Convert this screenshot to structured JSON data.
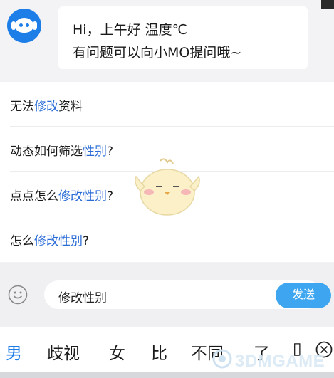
{
  "chat": {
    "greeting_line1": "Hi，上午好 温度℃",
    "greeting_line2": "有问题可以向小MO提问哦~"
  },
  "suggestions": [
    {
      "before": "无法",
      "highlight": "修改",
      "after": "资料"
    },
    {
      "before": "动态如何筛选",
      "highlight": "性别",
      "after": "?"
    },
    {
      "before": "点点怎么",
      "highlight": "修改性别",
      "after": "?"
    },
    {
      "before": "怎么",
      "highlight": "修改性别",
      "after": "?"
    }
  ],
  "input": {
    "value": "修改性别",
    "send_label": "发送"
  },
  "keyboard": {
    "candidates": [
      "男",
      "歧视",
      "女",
      "比",
      "不同",
      "了",
      "▯"
    ]
  },
  "watermark": "3DMGAME",
  "colors": {
    "accent": "#1e7ee8",
    "highlight": "#2a6cd6",
    "send": "#3ea6f0"
  }
}
